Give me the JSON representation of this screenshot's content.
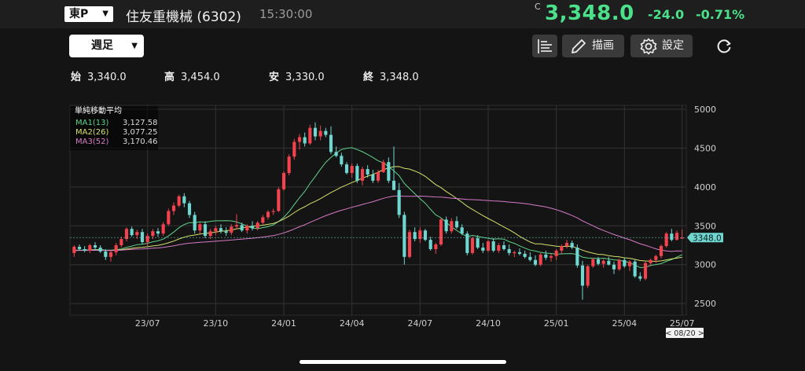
{
  "header": {
    "market": "東P",
    "name": "住友重機械",
    "code": "(6302)",
    "time": "15:30:00",
    "price_prefix": "C",
    "price": "3,348.0",
    "change": "-24.0",
    "change_pct": "-0.71%"
  },
  "toolbar": {
    "period": "週足",
    "draw_label": "描画",
    "settings_label": "設定",
    "icons": [
      "list-icon",
      "pencil-icon",
      "gear-icon",
      "refresh-icon"
    ]
  },
  "ohlc": {
    "open_label": "始",
    "open": "3,340.0",
    "high_label": "高",
    "high": "3,454.0",
    "low_label": "安",
    "low": "3,330.0",
    "close_label": "終",
    "close": "3,348.0"
  },
  "legend": {
    "title": "単純移動平均",
    "items": [
      {
        "name": "MA1(13)",
        "value": "3,127.58",
        "color": "#5fd38a"
      },
      {
        "name": "MA2(26)",
        "value": "3,077.25",
        "color": "#d6e06a"
      },
      {
        "name": "MA3(52)",
        "value": "3,170.46",
        "color": "#d67ac8"
      }
    ]
  },
  "chart_data": {
    "type": "candlestick",
    "x_tick_labels": [
      "23/07",
      "23/10",
      "24/01",
      "24/04",
      "24/07",
      "24/10",
      "25/01",
      "25/04",
      "25/07"
    ],
    "y_tick_labels": [
      "5000",
      "4500",
      "4000",
      "3500",
      "3000",
      "2500"
    ],
    "ylim": [
      2350,
      5050
    ],
    "y_ticks": [
      5000,
      4500,
      4000,
      3500,
      3000,
      2500
    ],
    "grid": true,
    "up_color": "#f2434f",
    "down_color": "#6fd6d0",
    "last_price_label": "3348.0",
    "last_price": 3348,
    "date_marker": "< 08/20 >",
    "candles": [
      [
        3150,
        3250,
        3100,
        3230
      ],
      [
        3230,
        3260,
        3180,
        3200
      ],
      [
        3200,
        3240,
        3160,
        3180
      ],
      [
        3180,
        3270,
        3150,
        3250
      ],
      [
        3250,
        3290,
        3200,
        3220
      ],
      [
        3220,
        3250,
        3150,
        3170
      ],
      [
        3170,
        3200,
        3060,
        3100
      ],
      [
        3100,
        3180,
        3040,
        3160
      ],
      [
        3160,
        3280,
        3120,
        3250
      ],
      [
        3250,
        3360,
        3220,
        3330
      ],
      [
        3330,
        3480,
        3300,
        3460
      ],
      [
        3460,
        3490,
        3360,
        3380
      ],
      [
        3380,
        3450,
        3330,
        3420
      ],
      [
        3420,
        3460,
        3260,
        3290
      ],
      [
        3290,
        3400,
        3240,
        3370
      ],
      [
        3370,
        3460,
        3330,
        3430
      ],
      [
        3430,
        3470,
        3360,
        3400
      ],
      [
        3400,
        3550,
        3370,
        3520
      ],
      [
        3520,
        3720,
        3500,
        3690
      ],
      [
        3690,
        3800,
        3640,
        3760
      ],
      [
        3760,
        3900,
        3740,
        3880
      ],
      [
        3880,
        3920,
        3740,
        3790
      ],
      [
        3790,
        3820,
        3600,
        3640
      ],
      [
        3640,
        3680,
        3400,
        3440
      ],
      [
        3440,
        3540,
        3400,
        3520
      ],
      [
        3520,
        3560,
        3340,
        3370
      ],
      [
        3370,
        3460,
        3330,
        3430
      ],
      [
        3430,
        3500,
        3380,
        3470
      ],
      [
        3470,
        3520,
        3400,
        3430
      ],
      [
        3430,
        3480,
        3370,
        3410
      ],
      [
        3410,
        3520,
        3380,
        3490
      ],
      [
        3490,
        3650,
        3460,
        3510
      ],
      [
        3510,
        3540,
        3420,
        3440
      ],
      [
        3440,
        3520,
        3400,
        3500
      ],
      [
        3500,
        3560,
        3440,
        3470
      ],
      [
        3470,
        3560,
        3440,
        3540
      ],
      [
        3540,
        3640,
        3520,
        3610
      ],
      [
        3610,
        3700,
        3580,
        3680
      ],
      [
        3680,
        3720,
        3640,
        3690
      ],
      [
        3690,
        4000,
        3680,
        3970
      ],
      [
        3970,
        4200,
        3950,
        4180
      ],
      [
        4180,
        4420,
        4150,
        4390
      ],
      [
        4390,
        4620,
        4350,
        4580
      ],
      [
        4580,
        4680,
        4480,
        4640
      ],
      [
        4640,
        4700,
        4520,
        4560
      ],
      [
        4560,
        4800,
        4540,
        4760
      ],
      [
        4760,
        4830,
        4600,
        4650
      ],
      [
        4650,
        4790,
        4600,
        4720
      ],
      [
        4720,
        4760,
        4640,
        4670
      ],
      [
        4670,
        4780,
        4420,
        4450
      ],
      [
        4450,
        4520,
        4380,
        4400
      ],
      [
        4400,
        4440,
        4260,
        4290
      ],
      [
        4290,
        4320,
        4160,
        4180
      ],
      [
        4180,
        4300,
        4120,
        4270
      ],
      [
        4270,
        4300,
        4050,
        4080
      ],
      [
        4080,
        4260,
        4020,
        4230
      ],
      [
        4230,
        4280,
        4120,
        4160
      ],
      [
        4160,
        4220,
        4050,
        4080
      ],
      [
        4080,
        4220,
        4050,
        4190
      ],
      [
        4190,
        4350,
        4180,
        4320
      ],
      [
        4320,
        4380,
        4050,
        4080
      ],
      [
        4080,
        4520,
        4020,
        3960
      ],
      [
        3960,
        4050,
        3600,
        3640
      ],
      [
        3640,
        3680,
        3000,
        3100
      ],
      [
        3100,
        3450,
        3080,
        3420
      ],
      [
        3420,
        3480,
        3300,
        3330
      ],
      [
        3330,
        3480,
        3280,
        3440
      ],
      [
        3440,
        3460,
        3300,
        3320
      ],
      [
        3320,
        3360,
        3180,
        3200
      ],
      [
        3200,
        3280,
        3140,
        3260
      ],
      [
        3260,
        3600,
        3240,
        3580
      ],
      [
        3580,
        3620,
        3400,
        3430
      ],
      [
        3430,
        3600,
        3400,
        3560
      ],
      [
        3560,
        3620,
        3460,
        3480
      ],
      [
        3480,
        3520,
        3380,
        3400
      ],
      [
        3400,
        3430,
        3120,
        3150
      ],
      [
        3150,
        3360,
        3130,
        3340
      ],
      [
        3340,
        3380,
        3200,
        3220
      ],
      [
        3220,
        3280,
        3150,
        3180
      ],
      [
        3180,
        3320,
        3160,
        3300
      ],
      [
        3300,
        3340,
        3160,
        3180
      ],
      [
        3180,
        3280,
        3150,
        3250
      ],
      [
        3250,
        3300,
        3180,
        3200
      ],
      [
        3200,
        3260,
        3120,
        3150
      ],
      [
        3150,
        3180,
        3100,
        3160
      ],
      [
        3160,
        3210,
        3120,
        3140
      ],
      [
        3140,
        3180,
        3080,
        3100
      ],
      [
        3100,
        3160,
        3040,
        3060
      ],
      [
        3060,
        3120,
        2980,
        3000
      ],
      [
        3000,
        3150,
        2980,
        3130
      ],
      [
        3130,
        3180,
        3060,
        3090
      ],
      [
        3090,
        3140,
        3040,
        3110
      ],
      [
        3110,
        3200,
        3060,
        3180
      ],
      [
        3180,
        3260,
        3140,
        3240
      ],
      [
        3240,
        3320,
        3210,
        3280
      ],
      [
        3280,
        3310,
        3200,
        3220
      ],
      [
        3220,
        3260,
        2960,
        2990
      ],
      [
        2990,
        3050,
        2550,
        2730
      ],
      [
        2730,
        3000,
        2700,
        2980
      ],
      [
        2980,
        3090,
        2960,
        3070
      ],
      [
        3070,
        3100,
        2990,
        3010
      ],
      [
        3010,
        3070,
        2960,
        3050
      ],
      [
        3050,
        3100,
        2990,
        3000
      ],
      [
        3000,
        3040,
        2880,
        2940
      ],
      [
        2940,
        3080,
        2920,
        3060
      ],
      [
        3060,
        3090,
        2960,
        2980
      ],
      [
        2980,
        3060,
        2920,
        3040
      ],
      [
        3040,
        3070,
        2830,
        2850
      ],
      [
        2850,
        2900,
        2790,
        2820
      ],
      [
        2820,
        3040,
        2800,
        3020
      ],
      [
        3020,
        3080,
        2980,
        3060
      ],
      [
        3060,
        3130,
        3020,
        3110
      ],
      [
        3110,
        3260,
        3080,
        3240
      ],
      [
        3240,
        3420,
        3220,
        3400
      ],
      [
        3400,
        3460,
        3300,
        3320
      ],
      [
        3320,
        3440,
        3310,
        3410
      ],
      [
        3340,
        3454,
        3330,
        3348
      ]
    ],
    "series": [
      {
        "name": "MA1(13)",
        "color": "#5fd38a"
      },
      {
        "name": "MA2(26)",
        "color": "#d6e06a"
      },
      {
        "name": "MA3(52)",
        "color": "#d67ac8"
      }
    ]
  }
}
